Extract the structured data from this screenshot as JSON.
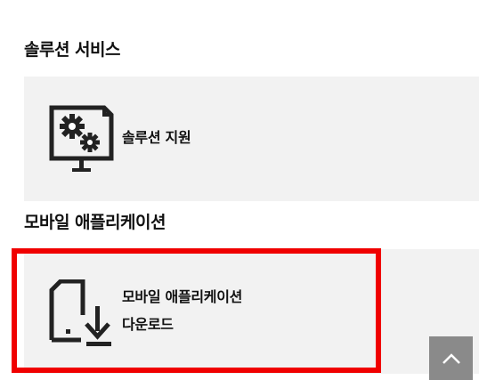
{
  "sections": {
    "solution": {
      "title": "솔루션 서비스",
      "card": {
        "label": "솔루션 지원",
        "icon": "monitor-gears-icon"
      }
    },
    "mobile": {
      "title": "모바일 애플리케이션",
      "card": {
        "label_line1": "모바일 애플리케이션",
        "label_line2": "다운로드",
        "icon": "mobile-download-icon"
      }
    }
  },
  "scroll_top": {
    "icon": "chevron-up-icon"
  },
  "colors": {
    "card_background": "#f2f2f2",
    "highlight": "#f00000",
    "scroll_button": "#8a8a8a",
    "text": "#111111"
  }
}
